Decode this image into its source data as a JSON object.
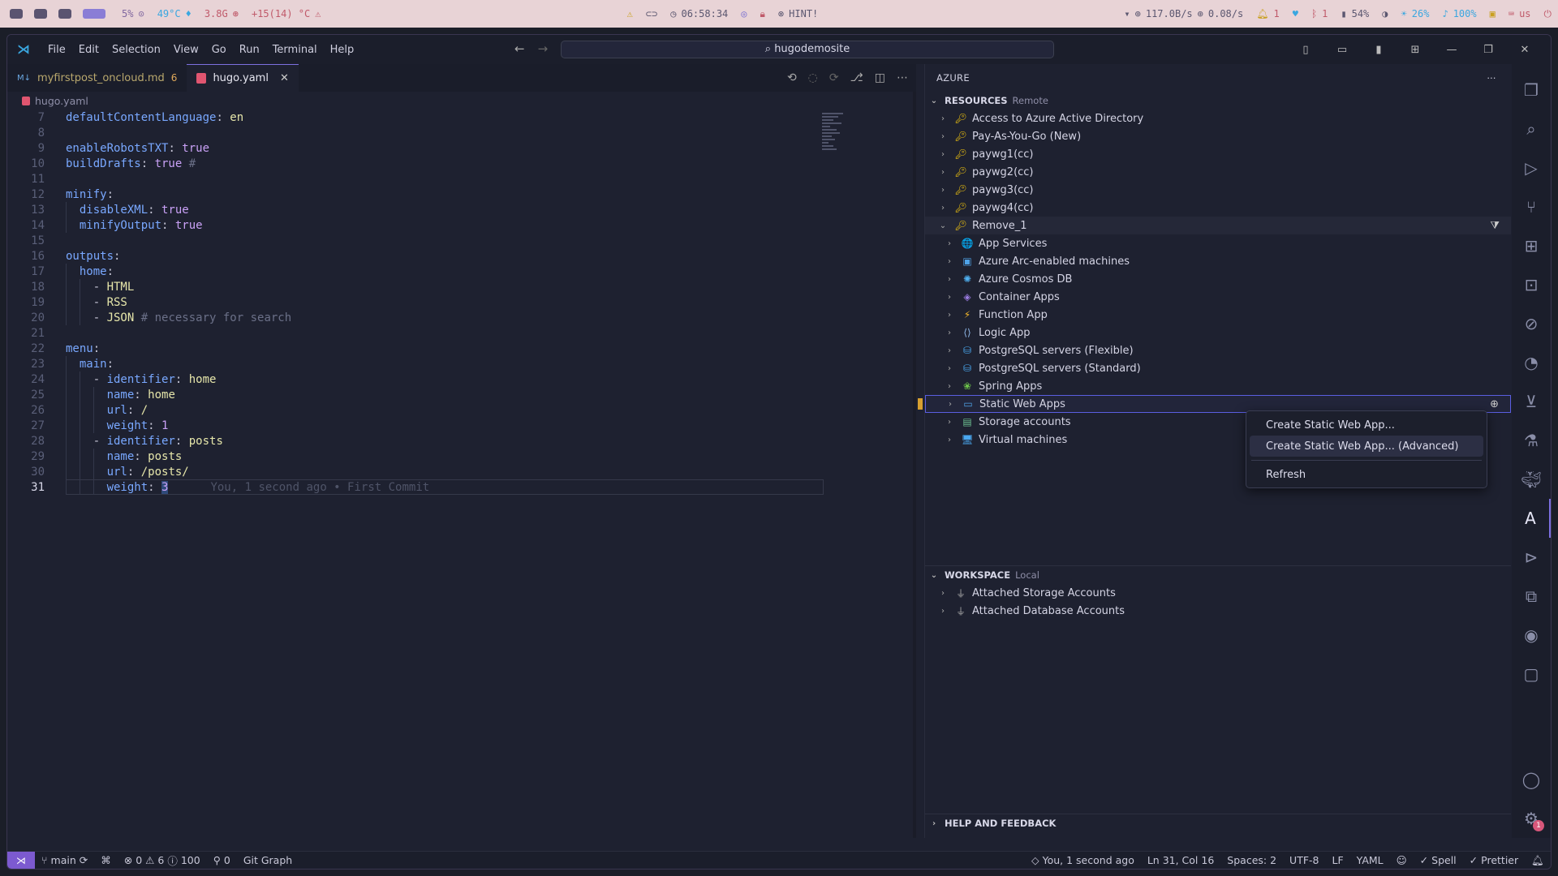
{
  "sysbar": {
    "cpu": "5%",
    "temp": "49°C",
    "mem": "3.8G",
    "weather": "+15(14) °C",
    "clock": "06:58:34",
    "hint": "HINT!",
    "net_down": "117.0B/s",
    "net_up": "0.08/s",
    "notif": "1",
    "bt": "1",
    "battery": "54%",
    "brightness": "26%",
    "volume": "100%",
    "kbd": "us"
  },
  "titlebar": {
    "menu": [
      "File",
      "Edit",
      "Selection",
      "View",
      "Go",
      "Run",
      "Terminal",
      "Help"
    ],
    "search": "hugodemosite"
  },
  "tabs": [
    {
      "label": "myfirstpost_oncloud.md",
      "badge": "6"
    },
    {
      "label": "hugo.yaml"
    }
  ],
  "breadcrumb": "hugo.yaml",
  "code": {
    "lines": [
      {
        "n": "7",
        "key": "defaultContentLanguage",
        "val": "en",
        "valClass": "s"
      },
      {
        "n": "8"
      },
      {
        "n": "9",
        "key": "enableRobotsTXT",
        "val": "true",
        "valClass": "v"
      },
      {
        "n": "10",
        "key": "buildDrafts",
        "val": "true",
        "valClass": "v",
        "comment": "#"
      },
      {
        "n": "11"
      },
      {
        "n": "12",
        "key": "minify"
      },
      {
        "n": "13",
        "indent": 1,
        "key": "disableXML",
        "val": "true",
        "valClass": "v"
      },
      {
        "n": "14",
        "indent": 1,
        "key": "minifyOutput",
        "val": "true",
        "valClass": "v"
      },
      {
        "n": "15"
      },
      {
        "n": "16",
        "key": "outputs"
      },
      {
        "n": "17",
        "indent": 1,
        "key": "home"
      },
      {
        "n": "18",
        "indent": 2,
        "dash": true,
        "item": "HTML"
      },
      {
        "n": "19",
        "indent": 2,
        "dash": true,
        "item": "RSS"
      },
      {
        "n": "20",
        "indent": 2,
        "dash": true,
        "item": "JSON",
        "comment": "# necessary for search"
      },
      {
        "n": "21"
      },
      {
        "n": "22",
        "key": "menu"
      },
      {
        "n": "23",
        "indent": 1,
        "key": "main"
      },
      {
        "n": "24",
        "indent": 2,
        "dash": true,
        "key": "identifier",
        "val": "home",
        "valClass": "s"
      },
      {
        "n": "25",
        "indent": 3,
        "key": "name",
        "val": "home",
        "valClass": "s"
      },
      {
        "n": "26",
        "indent": 3,
        "key": "url",
        "val": "/",
        "valClass": "s"
      },
      {
        "n": "27",
        "indent": 3,
        "key": "weight",
        "val": "1",
        "valClass": "v"
      },
      {
        "n": "28",
        "indent": 2,
        "dash": true,
        "key": "identifier",
        "val": "posts",
        "valClass": "s"
      },
      {
        "n": "29",
        "indent": 3,
        "key": "name",
        "val": "posts",
        "valClass": "s"
      },
      {
        "n": "30",
        "indent": 3,
        "key": "url",
        "val": "/posts/",
        "valClass": "s"
      },
      {
        "n": "31",
        "indent": 3,
        "key": "weight",
        "val": "3",
        "valClass": "v",
        "current": true,
        "blame": "You, 1 second ago • First Commit"
      }
    ]
  },
  "azure": {
    "title": "AZURE",
    "resources": {
      "label": "RESOURCES",
      "sub": "Remote",
      "subscriptions": [
        "Access to Azure Active Directory",
        "Pay-As-You-Go (New)",
        "paywg1(cc)",
        "paywg2(cc)",
        "paywg3(cc)",
        "paywg4(cc)"
      ],
      "expanded": {
        "label": "Remove_1",
        "children": [
          {
            "label": "App Services",
            "icon": "🌐",
            "color": "#3aa7e0"
          },
          {
            "label": "Azure Arc-enabled machines",
            "icon": "▣",
            "color": "#4fa3e8"
          },
          {
            "label": "Azure Cosmos DB",
            "icon": "✺",
            "color": "#4fb0f0"
          },
          {
            "label": "Container Apps",
            "icon": "◈",
            "color": "#9a7be0"
          },
          {
            "label": "Function App",
            "icon": "⚡",
            "color": "#f5b72a"
          },
          {
            "label": "Logic App",
            "icon": "⟨⟩",
            "color": "#8fb8e8"
          },
          {
            "label": "PostgreSQL servers (Flexible)",
            "icon": "⛁",
            "color": "#4aa8f0"
          },
          {
            "label": "PostgreSQL servers (Standard)",
            "icon": "⛁",
            "color": "#4aa8f0"
          },
          {
            "label": "Spring Apps",
            "icon": "❀",
            "color": "#6cc24a"
          },
          {
            "label": "Static Web Apps",
            "icon": "▭",
            "color": "#4fa3e8"
          },
          {
            "label": "Storage accounts",
            "icon": "▤",
            "color": "#6cc090"
          },
          {
            "label": "Virtual machines",
            "icon": "🖥",
            "color": "#4aa8f0"
          }
        ]
      }
    },
    "workspace": {
      "label": "WORKSPACE",
      "sub": "Local",
      "items": [
        "Attached Storage Accounts",
        "Attached Database Accounts"
      ]
    },
    "help": "HELP AND FEEDBACK"
  },
  "context_menu": [
    {
      "label": "Create Static Web App..."
    },
    {
      "label": "Create Static Web App... (Advanced)",
      "highlight": true
    },
    {
      "label": "Refresh",
      "sepBefore": true
    }
  ],
  "status": {
    "branch": "main",
    "errors": "0",
    "warnings": "6",
    "info": "100",
    "ports": "0",
    "git_graph": "Git Graph",
    "blame": "You, 1 second ago",
    "position": "Ln 31, Col 16",
    "spaces": "Spaces: 2",
    "encoding": "UTF-8",
    "eol": "LF",
    "language": "YAML",
    "spell": "Spell",
    "prettier": "Prettier"
  },
  "activity_badge": "1"
}
